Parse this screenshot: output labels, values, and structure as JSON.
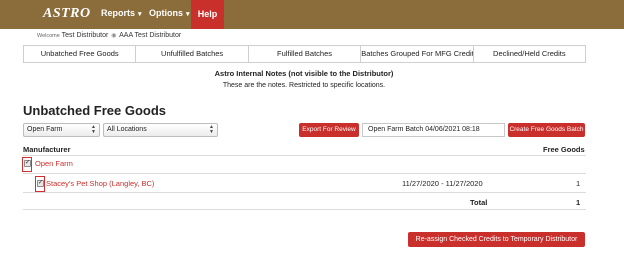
{
  "navbar": {
    "logo": "ASTRO",
    "menu": [
      {
        "label": "Reports"
      },
      {
        "label": "Options"
      }
    ],
    "help_label": "Help"
  },
  "welcome": {
    "prefix": "Welcome",
    "user": "Test Distributor",
    "location": "AAA Test Distributor"
  },
  "tabs": [
    {
      "label": "Unbatched Free Goods"
    },
    {
      "label": "Unfulfilled Batches"
    },
    {
      "label": "Fulfilled Batches"
    },
    {
      "label": "Batches Grouped For MFG Credit"
    },
    {
      "label": "Declined/Held Credits"
    }
  ],
  "notes": {
    "title": "Astro Internal Notes (not visible to the Distributor)",
    "text": "These are the notes. Restricted to specific locations."
  },
  "section_title": "Unbatched Free Goods",
  "filters": {
    "manufacturer_selected": "Open Farm",
    "location_selected": "All Locations",
    "export_label": "Export For Review",
    "batch_name_value": "Open Farm Batch 04/06/2021 08:18",
    "create_label": "Create Free Goods Batch"
  },
  "table": {
    "headers": {
      "manufacturer": "Manufacturer",
      "free_goods": "Free Goods"
    },
    "group": {
      "name": "Open Farm",
      "checked": true
    },
    "rows": [
      {
        "name": "Stacey's Pet Shop (Langley, BC)",
        "date_range": "11/27/2020 - 11/27/2020",
        "count": "1",
        "checked": true
      }
    ],
    "total_label": "Total",
    "total_value": "1"
  },
  "reassign_label": "Re-assign Checked Credits to Temporary Distributor",
  "colors": {
    "navbar": "#8a6d3b",
    "accent_red": "#c9302c",
    "highlight_box": "#d32f2f"
  },
  "icons": {
    "checkbox_checked": "check-icon",
    "select_arrows": "up-down-arrows-icon",
    "menu_caret": "caret-down-icon"
  }
}
